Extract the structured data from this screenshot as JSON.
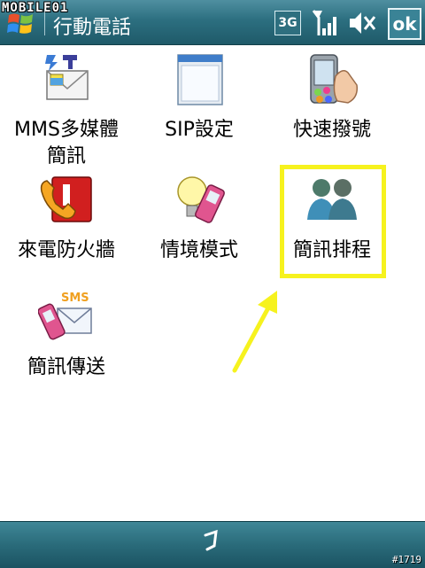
{
  "statusbar": {
    "brand": "MOBILE01",
    "title": "行動電話",
    "network": "3G",
    "ok_label": "ok",
    "icons": [
      "windows-start-icon",
      "signal-icon",
      "volume-muted-icon"
    ]
  },
  "items": [
    {
      "label_lines": [
        "MMS多媒體",
        "簡訊"
      ],
      "icon": "mms-settings-icon"
    },
    {
      "label_lines": [
        "SIP設定"
      ],
      "icon": "sip-settings-icon"
    },
    {
      "label_lines": [
        "快速撥號"
      ],
      "icon": "speed-dial-icon"
    },
    {
      "label_lines": [
        "來電防火牆"
      ],
      "icon": "call-firewall-icon"
    },
    {
      "label_lines": [
        "情境模式"
      ],
      "icon": "profiles-icon"
    },
    {
      "label_lines": [
        "簡訊排程"
      ],
      "icon": "sms-schedule-icon",
      "selected": true
    },
    {
      "label_lines": [
        "簡訊傳送"
      ],
      "icon": "sms-send-icon"
    }
  ],
  "sms_icon_text": "SMS",
  "watermark": "#1719",
  "colors": {
    "titlebar": "#2c6f80",
    "highlight": "#f6f21e",
    "selection": "#30a9c5"
  }
}
